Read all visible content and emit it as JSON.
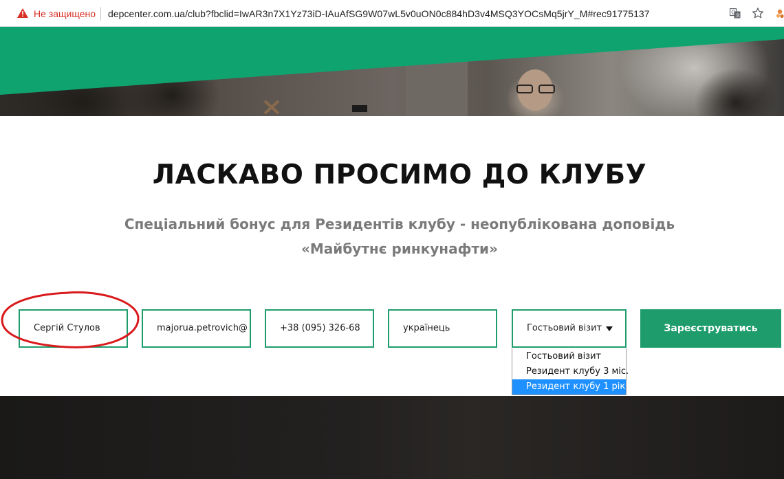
{
  "browser": {
    "security_label": "Не защищено",
    "url": "depcenter.com.ua/club?fbclid=IwAR3n7X1Yz73iD-IAuAfSG9W07wL5v0uON0c884hD3v4MSQ3YOCsMq5jrY_M#rec91775137",
    "icons": [
      "warning-icon",
      "translate-icon",
      "star-icon",
      "extension-icon"
    ]
  },
  "page": {
    "title": "ЛАСКАВО ПРОСИМО ДО КЛУБУ",
    "subtitle_line1": "Спеціальний бонус для Резидентів клубу - неопублікована доповідь",
    "subtitle_line2": "«Майбутнє ринкунафти»"
  },
  "form": {
    "name_value": "Сергій Стулов",
    "email_value": "majorua.petrovich@",
    "phone_value": "+38 (095) 326-68",
    "nationality_value": "українець",
    "visit_type_value": "Гостьовий візит",
    "visit_type_options": [
      "Гостьовий візит",
      "Резидент клубу 3 міс.",
      "Резидент клубу 1 рік"
    ],
    "highlighted_option": "Резидент клубу 1 рік",
    "submit_label": "Зареєструватись"
  },
  "colors": {
    "brand_green": "#1f9c6c",
    "hero_green": "#0fa36f",
    "security_red": "#d93025",
    "annotation_red": "#d9191b",
    "dropdown_highlight": "#1e90ff"
  }
}
